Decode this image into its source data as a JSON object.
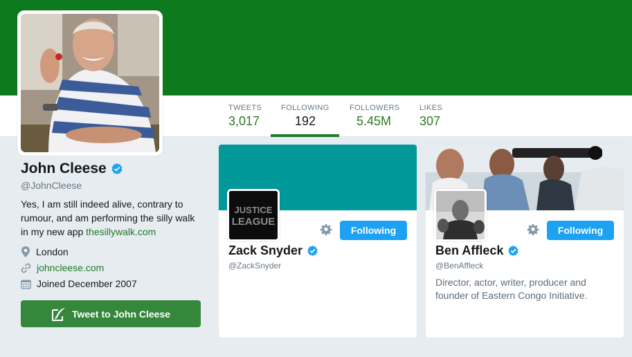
{
  "profile": {
    "name": "John Cleese",
    "handle": "@JohnCleese",
    "bio_text": "Yes, I am still indeed alive, contrary to rumour, and am performing the silly walk in my new app",
    "bio_link": "thesillywalk.com",
    "location": "London",
    "website": "johncleese.com",
    "joined": "Joined December 2007",
    "tweet_button": "Tweet to John Cleese"
  },
  "stats": [
    {
      "label": "TWEETS",
      "value": "3,017"
    },
    {
      "label": "FOLLOWING",
      "value": "192"
    },
    {
      "label": "FOLLOWERS",
      "value": "5.45M"
    },
    {
      "label": "LIKES",
      "value": "307"
    }
  ],
  "cards": [
    {
      "name": "Zack Snyder",
      "handle": "@ZackSnyder",
      "bio": "",
      "button": "Following",
      "avatar_text_1": "JUSTICE",
      "avatar_text_2": "LEAGUE"
    },
    {
      "name": "Ben Affleck",
      "handle": "@BenAffleck",
      "bio": "Director, actor, writer, producer and founder of Eastern Congo Initiative.",
      "button": "Following"
    }
  ],
  "colors": {
    "banner": "#0c7a1d",
    "accent": "#1f7a2a",
    "follow_button": "#1da1f2",
    "tweet_button": "#35873c",
    "card_cover_teal": "#009898"
  },
  "icons": {
    "verified": "verified-badge-icon",
    "location": "location-pin-icon",
    "website": "link-icon",
    "joined": "calendar-icon",
    "settings": "gear-icon",
    "compose": "quill-icon"
  }
}
